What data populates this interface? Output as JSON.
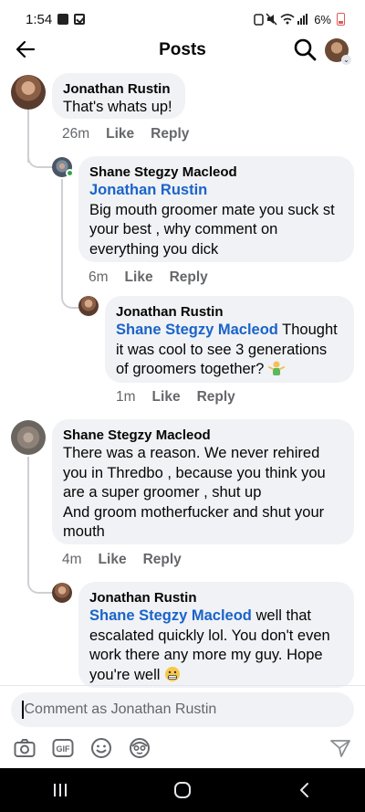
{
  "status_bar": {
    "time": "1:54",
    "battery": "6%"
  },
  "header": {
    "title": "Posts"
  },
  "comments": [
    {
      "author": "Jonathan Rustin",
      "text": "That's whats up!",
      "time": "26m",
      "like": "Like",
      "reply": "Reply"
    },
    {
      "author": "Shane Stegzy Macleod",
      "mention": "Jonathan Rustin",
      "lines": [
        "Big mouth groomer mate you suck st",
        "your best , why comment on",
        "everything you dick"
      ],
      "time": "6m",
      "like": "Like",
      "reply": "Reply"
    },
    {
      "author": "Jonathan Rustin",
      "mention": "Shane Stegzy Macleod",
      "line1_after_mention": " Thought",
      "lines": [
        "it was cool to see 3 generations",
        "of  groomers together?"
      ],
      "time": "1m",
      "like": "Like",
      "reply": "Reply"
    },
    {
      "author": "Shane Stegzy Macleod",
      "lines": [
        "There was a reason. We never rehired",
        "you in Thredbo  , because you think you",
        "are a super groomer , shut up",
        "And groom motherfucker and shut your",
        "mouth"
      ],
      "time": "4m",
      "like": "Like",
      "reply": "Reply"
    },
    {
      "author": "Jonathan Rustin",
      "mention": "Shane Stegzy Macleod",
      "line1_after_mention": " well that",
      "lines": [
        "escalated quickly lol. You don't even",
        "work there any more my guy. Hope",
        "you're well"
      ]
    }
  ],
  "composer": {
    "placeholder": "Comment as Jonathan Rustin"
  },
  "icons": {
    "back": "arrow-left-icon",
    "search": "search-icon",
    "camera": "camera-icon",
    "gif": "gif-icon",
    "emoji": "smiley-icon",
    "avatar_sticker": "avatar-sticker-icon",
    "send": "send-icon"
  },
  "colors": {
    "mention": "#1a63c9",
    "bubble": "#f0f2f5",
    "meta": "#65676b",
    "online": "#31a24c"
  }
}
